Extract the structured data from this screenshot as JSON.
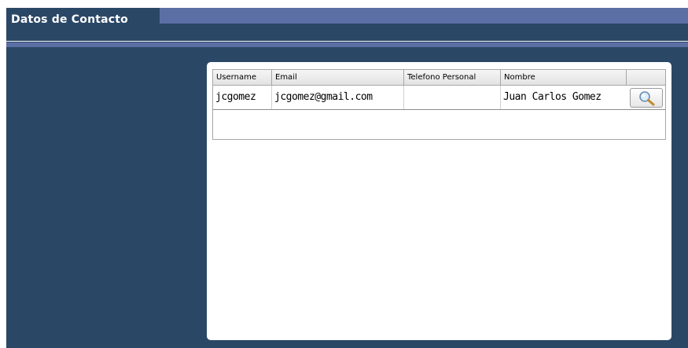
{
  "header": {
    "title": "Datos de Contacto"
  },
  "table": {
    "columns": [
      "Username",
      "Email",
      "Telefono Personal",
      "Nombre",
      ""
    ],
    "rows": [
      {
        "username": "jcgomez",
        "email": "jcgomez@gmail.com",
        "telefono": "",
        "nombre": "Juan Carlos Gomez",
        "action_icon": "search-icon"
      }
    ]
  },
  "colors": {
    "background": "#2a4766",
    "header_band": "#5b6fa5",
    "panel": "#ffffff"
  }
}
